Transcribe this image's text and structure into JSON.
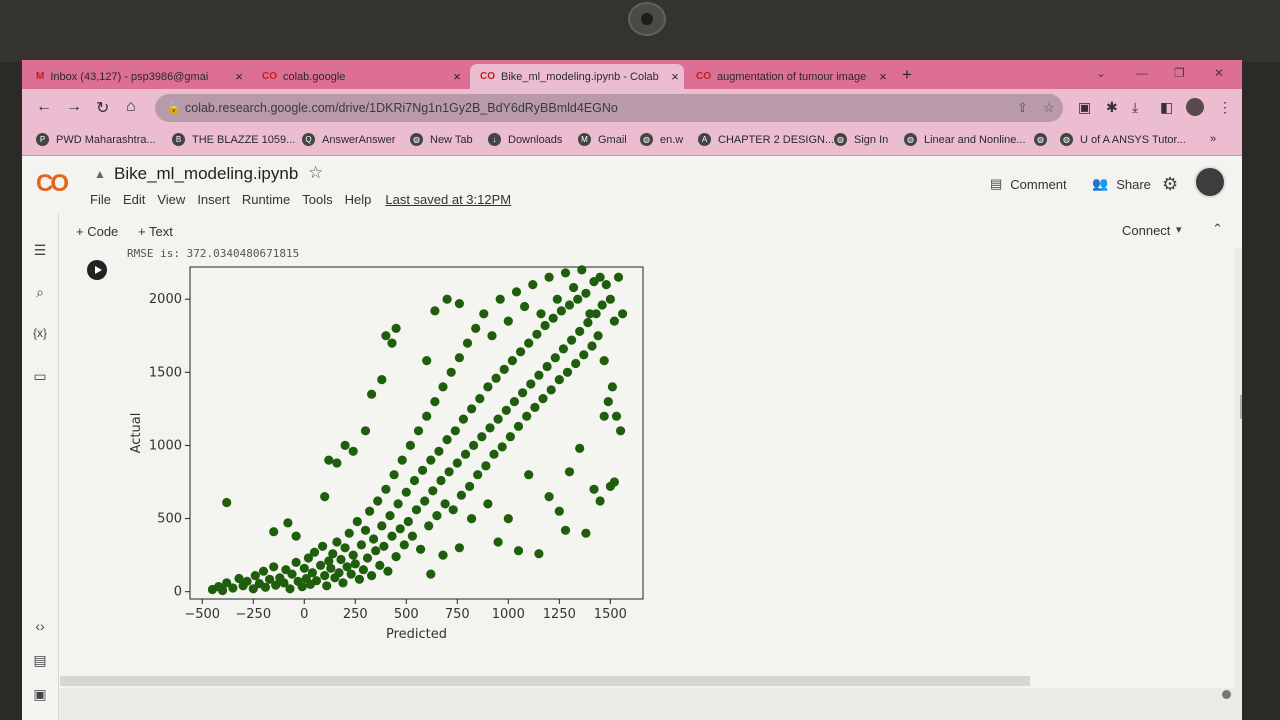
{
  "tabs": [
    {
      "label": "Inbox (43,127) - psp3986@gmai",
      "icon": "gmail-icon",
      "active": false
    },
    {
      "label": "colab.google",
      "icon": "colab-icon",
      "active": false
    },
    {
      "label": "Bike_ml_modeling.ipynb - Colab",
      "icon": "colab-icon",
      "active": true
    },
    {
      "label": "augmentation of tumour image",
      "icon": "colab-icon",
      "active": false
    }
  ],
  "omnibox": {
    "url": "colab.research.google.com/drive/1DKRi7Ng1n1Gy2B_BdY6dRyBBmld4EGNo"
  },
  "bookmarks": [
    "PWD Maharashtra...",
    "THE BLAZZE 1059...",
    "AnswerAnswer",
    "New Tab",
    "Downloads",
    "Gmail",
    "en.w",
    "CHAPTER 2 DESIGN...",
    "Sign In",
    "Linear and Nonline...",
    "U of A ANSYS Tutor..."
  ],
  "colab": {
    "logo": "CO",
    "notebook_title": "Bike_ml_modeling.ipynb",
    "menu": [
      "File",
      "Edit",
      "View",
      "Insert",
      "Runtime",
      "Tools",
      "Help"
    ],
    "last_saved": "Last saved at 3:12PM",
    "comment": "Comment",
    "share": "Share",
    "add_code": "+ Code",
    "add_text": "+ Text",
    "connect": "Connect"
  },
  "cell": {
    "output_text": "RMSE is: 372.0340480671815"
  },
  "colors": {
    "point": "#1f5e0c",
    "tabbar": "#dc6f93",
    "toolbar": "#ecbcd0"
  },
  "chart_data": {
    "type": "scatter",
    "xlabel": "Predicted",
    "ylabel": "Actual",
    "xlim": [
      -560,
      1660
    ],
    "ylim": [
      -50,
      2220
    ],
    "xticks": [
      -500,
      -250,
      0,
      250,
      500,
      750,
      1000,
      1250,
      1500
    ],
    "yticks": [
      0,
      500,
      1000,
      1500,
      2000
    ],
    "points": [
      [
        -450,
        15
      ],
      [
        -420,
        35
      ],
      [
        -400,
        8
      ],
      [
        -380,
        60
      ],
      [
        -350,
        25
      ],
      [
        -320,
        90
      ],
      [
        -300,
        40
      ],
      [
        -280,
        70
      ],
      [
        -250,
        20
      ],
      [
        -240,
        110
      ],
      [
        -220,
        55
      ],
      [
        -200,
        140
      ],
      [
        -190,
        30
      ],
      [
        -170,
        85
      ],
      [
        -150,
        170
      ],
      [
        -140,
        45
      ],
      [
        -120,
        95
      ],
      [
        -100,
        60
      ],
      [
        -90,
        150
      ],
      [
        -70,
        20
      ],
      [
        -60,
        120
      ],
      [
        -40,
        200
      ],
      [
        -30,
        70
      ],
      [
        -10,
        35
      ],
      [
        0,
        160
      ],
      [
        10,
        90
      ],
      [
        20,
        230
      ],
      [
        30,
        50
      ],
      [
        40,
        130
      ],
      [
        50,
        270
      ],
      [
        60,
        75
      ],
      [
        80,
        180
      ],
      [
        90,
        310
      ],
      [
        100,
        110
      ],
      [
        110,
        40
      ],
      [
        120,
        210
      ],
      [
        130,
        160
      ],
      [
        140,
        260
      ],
      [
        150,
        95
      ],
      [
        160,
        340
      ],
      [
        170,
        130
      ],
      [
        180,
        220
      ],
      [
        190,
        60
      ],
      [
        200,
        300
      ],
      [
        210,
        170
      ],
      [
        220,
        400
      ],
      [
        230,
        120
      ],
      [
        240,
        250
      ],
      [
        250,
        190
      ],
      [
        260,
        480
      ],
      [
        270,
        85
      ],
      [
        280,
        320
      ],
      [
        290,
        150
      ],
      [
        300,
        420
      ],
      [
        310,
        230
      ],
      [
        320,
        550
      ],
      [
        330,
        110
      ],
      [
        340,
        360
      ],
      [
        350,
        280
      ],
      [
        360,
        620
      ],
      [
        370,
        180
      ],
      [
        380,
        450
      ],
      [
        390,
        310
      ],
      [
        400,
        700
      ],
      [
        410,
        140
      ],
      [
        420,
        520
      ],
      [
        430,
        380
      ],
      [
        440,
        800
      ],
      [
        450,
        240
      ],
      [
        460,
        600
      ],
      [
        470,
        430
      ],
      [
        480,
        900
      ],
      [
        490,
        320
      ],
      [
        500,
        680
      ],
      [
        510,
        480
      ],
      [
        520,
        1000
      ],
      [
        530,
        380
      ],
      [
        540,
        760
      ],
      [
        550,
        560
      ],
      [
        560,
        1100
      ],
      [
        570,
        290
      ],
      [
        580,
        830
      ],
      [
        590,
        620
      ],
      [
        600,
        1200
      ],
      [
        610,
        450
      ],
      [
        620,
        900
      ],
      [
        630,
        690
      ],
      [
        640,
        1300
      ],
      [
        650,
        520
      ],
      [
        660,
        960
      ],
      [
        670,
        760
      ],
      [
        680,
        1400
      ],
      [
        690,
        600
      ],
      [
        700,
        1040
      ],
      [
        710,
        820
      ],
      [
        720,
        1500
      ],
      [
        730,
        560
      ],
      [
        740,
        1100
      ],
      [
        750,
        880
      ],
      [
        760,
        1600
      ],
      [
        770,
        660
      ],
      [
        780,
        1180
      ],
      [
        790,
        940
      ],
      [
        800,
        1700
      ],
      [
        810,
        720
      ],
      [
        820,
        1250
      ],
      [
        830,
        1000
      ],
      [
        840,
        1800
      ],
      [
        850,
        800
      ],
      [
        860,
        1320
      ],
      [
        870,
        1060
      ],
      [
        880,
        1900
      ],
      [
        890,
        860
      ],
      [
        900,
        1400
      ],
      [
        910,
        1120
      ],
      [
        920,
        1750
      ],
      [
        930,
        940
      ],
      [
        940,
        1460
      ],
      [
        950,
        1180
      ],
      [
        960,
        2000
      ],
      [
        970,
        990
      ],
      [
        980,
        1520
      ],
      [
        990,
        1240
      ],
      [
        1000,
        1850
      ],
      [
        1010,
        1060
      ],
      [
        1020,
        1580
      ],
      [
        1030,
        1300
      ],
      [
        1040,
        2050
      ],
      [
        1050,
        1130
      ],
      [
        1060,
        1640
      ],
      [
        1070,
        1360
      ],
      [
        1080,
        1950
      ],
      [
        1090,
        1200
      ],
      [
        1100,
        1700
      ],
      [
        1110,
        1420
      ],
      [
        1120,
        2100
      ],
      [
        1130,
        1260
      ],
      [
        1140,
        1760
      ],
      [
        1150,
        1480
      ],
      [
        1160,
        1900
      ],
      [
        1170,
        1320
      ],
      [
        1180,
        1820
      ],
      [
        1190,
        1540
      ],
      [
        1200,
        2150
      ],
      [
        1210,
        1380
      ],
      [
        1220,
        1870
      ],
      [
        1230,
        1600
      ],
      [
        1240,
        2000
      ],
      [
        1250,
        1450
      ],
      [
        1260,
        1920
      ],
      [
        1270,
        1660
      ],
      [
        1280,
        2180
      ],
      [
        1290,
        1500
      ],
      [
        1300,
        1960
      ],
      [
        1310,
        1720
      ],
      [
        1320,
        2080
      ],
      [
        1330,
        1560
      ],
      [
        1340,
        2000
      ],
      [
        1350,
        1780
      ],
      [
        1360,
        2200
      ],
      [
        1370,
        1620
      ],
      [
        1380,
        2040
      ],
      [
        1390,
        1840
      ],
      [
        1400,
        1900
      ],
      [
        1410,
        1680
      ],
      [
        1420,
        2120
      ],
      [
        1430,
        1900
      ],
      [
        1440,
        1750
      ],
      [
        1450,
        2150
      ],
      [
        1460,
        1960
      ],
      [
        1470,
        1580
      ],
      [
        1480,
        2100
      ],
      [
        1490,
        1300
      ],
      [
        1500,
        2000
      ],
      [
        1510,
        1400
      ],
      [
        1520,
        1850
      ],
      [
        1530,
        1200
      ],
      [
        1540,
        2150
      ],
      [
        1550,
        1100
      ],
      [
        1560,
        1900
      ],
      [
        -380,
        610
      ],
      [
        -150,
        410
      ],
      [
        -80,
        470
      ],
      [
        -40,
        380
      ],
      [
        100,
        650
      ],
      [
        120,
        900
      ],
      [
        160,
        880
      ],
      [
        200,
        1000
      ],
      [
        240,
        960
      ],
      [
        300,
        1100
      ],
      [
        330,
        1350
      ],
      [
        380,
        1450
      ],
      [
        400,
        1750
      ],
      [
        430,
        1700
      ],
      [
        450,
        1800
      ],
      [
        600,
        1580
      ],
      [
        640,
        1920
      ],
      [
        700,
        2000
      ],
      [
        760,
        1970
      ],
      [
        1000,
        500
      ],
      [
        1100,
        800
      ],
      [
        1150,
        260
      ],
      [
        1200,
        650
      ],
      [
        1250,
        550
      ],
      [
        1280,
        420
      ],
      [
        1300,
        820
      ],
      [
        1380,
        400
      ],
      [
        1420,
        700
      ],
      [
        1470,
        1200
      ],
      [
        1500,
        720
      ],
      [
        1520,
        750
      ],
      [
        1450,
        620
      ],
      [
        1350,
        980
      ],
      [
        1050,
        280
      ],
      [
        950,
        340
      ],
      [
        900,
        600
      ],
      [
        820,
        500
      ],
      [
        760,
        300
      ],
      [
        680,
        250
      ],
      [
        620,
        120
      ]
    ]
  }
}
